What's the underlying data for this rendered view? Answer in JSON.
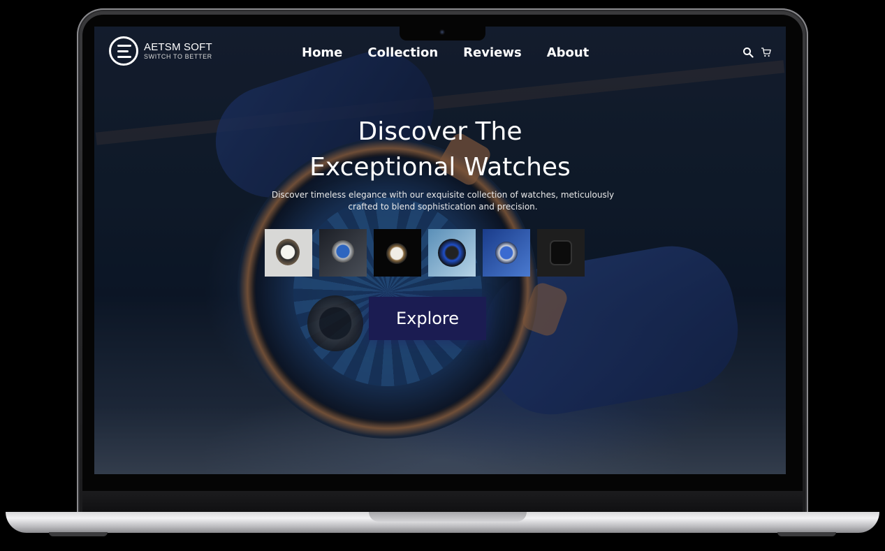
{
  "brand": {
    "name": "AETSM SOFT",
    "tagline": "SWITCH TO BETTER"
  },
  "nav": {
    "items": [
      "Home",
      "Collection",
      "Reviews",
      "About"
    ]
  },
  "header_icons": [
    "search-icon",
    "cart-icon"
  ],
  "hero": {
    "title_line1": "Discover The",
    "title_line2": "Exceptional Watches",
    "subtitle": "Discover timeless elegance with our exquisite collection of watches, meticulously crafted to blend sophistication and precision.",
    "cta_label": "Explore"
  },
  "thumbnails": [
    "watch-thumbnail-1",
    "watch-thumbnail-2",
    "watch-thumbnail-3",
    "watch-thumbnail-4",
    "watch-thumbnail-5",
    "watch-thumbnail-6"
  ],
  "colors": {
    "cta_background": "#1b1c52",
    "text": "#ffffff",
    "screen_background": "#12202f"
  }
}
